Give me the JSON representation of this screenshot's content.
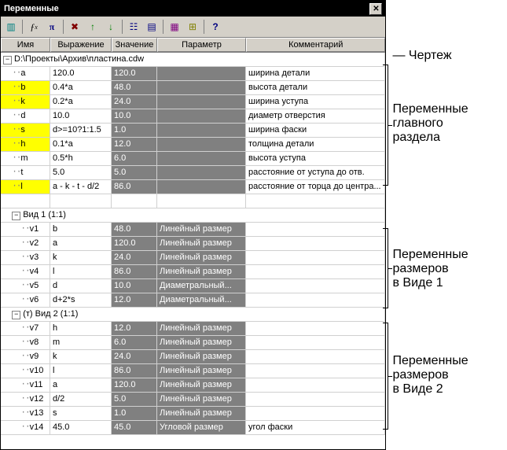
{
  "window": {
    "title": "Переменные"
  },
  "columns": {
    "name": "Имя",
    "expr": "Выражение",
    "val": "Значение",
    "par": "Параметр",
    "com": "Комментарий"
  },
  "root": {
    "path": "D:\\Проекты\\Архив\\пластина.cdw"
  },
  "main_vars": [
    {
      "name": "a",
      "expr": "120.0",
      "val": "120.0",
      "par": "",
      "com": "ширина детали",
      "hl": false
    },
    {
      "name": "b",
      "expr": "0.4*a",
      "val": "48.0",
      "par": "",
      "com": "высота детали",
      "hl": true
    },
    {
      "name": "k",
      "expr": "0.2*a",
      "val": "24.0",
      "par": "",
      "com": "ширина уступа",
      "hl": true
    },
    {
      "name": "d",
      "expr": "10.0",
      "val": "10.0",
      "par": "",
      "com": "диаметр отверстия",
      "hl": false
    },
    {
      "name": "s",
      "expr": "d>=10?1:1.5",
      "val": "1.0",
      "par": "",
      "com": "ширина фаски",
      "hl": true
    },
    {
      "name": "h",
      "expr": "0.1*a",
      "val": "12.0",
      "par": "",
      "com": "толщина детали",
      "hl": true
    },
    {
      "name": "m",
      "expr": "0.5*h",
      "val": "6.0",
      "par": "",
      "com": "высота уступа",
      "hl": false
    },
    {
      "name": "t",
      "expr": "5.0",
      "val": "5.0",
      "par": "",
      "com": "расстояние от уступа до отв.",
      "hl": false
    },
    {
      "name": "l",
      "expr": "a - k - t - d/2",
      "val": "86.0",
      "par": "",
      "com": "расстояние от торца до центра...",
      "hl": true
    }
  ],
  "view1": {
    "label": "Вид 1 (1:1)",
    "vars": [
      {
        "name": "v1",
        "expr": "b",
        "val": "48.0",
        "par": "Линейный размер",
        "com": ""
      },
      {
        "name": "v2",
        "expr": "a",
        "val": "120.0",
        "par": "Линейный размер",
        "com": ""
      },
      {
        "name": "v3",
        "expr": "k",
        "val": "24.0",
        "par": "Линейный размер",
        "com": ""
      },
      {
        "name": "v4",
        "expr": "l",
        "val": "86.0",
        "par": "Линейный размер",
        "com": ""
      },
      {
        "name": "v5",
        "expr": "d",
        "val": "10.0",
        "par": "Диаметральный...",
        "com": ""
      },
      {
        "name": "v6",
        "expr": "d+2*s",
        "val": "12.0",
        "par": "Диаметральный...",
        "com": ""
      }
    ]
  },
  "view2": {
    "label": "(т) Вид 2 (1:1)",
    "vars": [
      {
        "name": "v7",
        "expr": "h",
        "val": "12.0",
        "par": "Линейный размер",
        "com": ""
      },
      {
        "name": "v8",
        "expr": "m",
        "val": "6.0",
        "par": "Линейный размер",
        "com": ""
      },
      {
        "name": "v9",
        "expr": "k",
        "val": "24.0",
        "par": "Линейный размер",
        "com": ""
      },
      {
        "name": "v10",
        "expr": "l",
        "val": "86.0",
        "par": "Линейный размер",
        "com": ""
      },
      {
        "name": "v11",
        "expr": "a",
        "val": "120.0",
        "par": "Линейный размер",
        "com": ""
      },
      {
        "name": "v12",
        "expr": "d/2",
        "val": "5.0",
        "par": "Линейный размер",
        "com": ""
      },
      {
        "name": "v13",
        "expr": "s",
        "val": "1.0",
        "par": "Линейный размер",
        "com": ""
      },
      {
        "name": "v14",
        "expr": "45.0",
        "val": "45.0",
        "par": "Угловой размер",
        "com": "угол фаски"
      }
    ]
  },
  "annotations": {
    "drawing": "Чертеж",
    "main": "Переменные\nглавного\nраздела",
    "v1": "Переменные\nразмеров\nв Виде 1",
    "v2": "Переменные\nразмеров\nв Виде 2"
  },
  "toolbar_icons": [
    "column-icon",
    "fx-icon",
    "pi-icon",
    "delete-icon",
    "up-icon",
    "down-icon",
    "tree-icon",
    "table-icon",
    "grid-icon",
    "expand-icon",
    "help-icon"
  ]
}
